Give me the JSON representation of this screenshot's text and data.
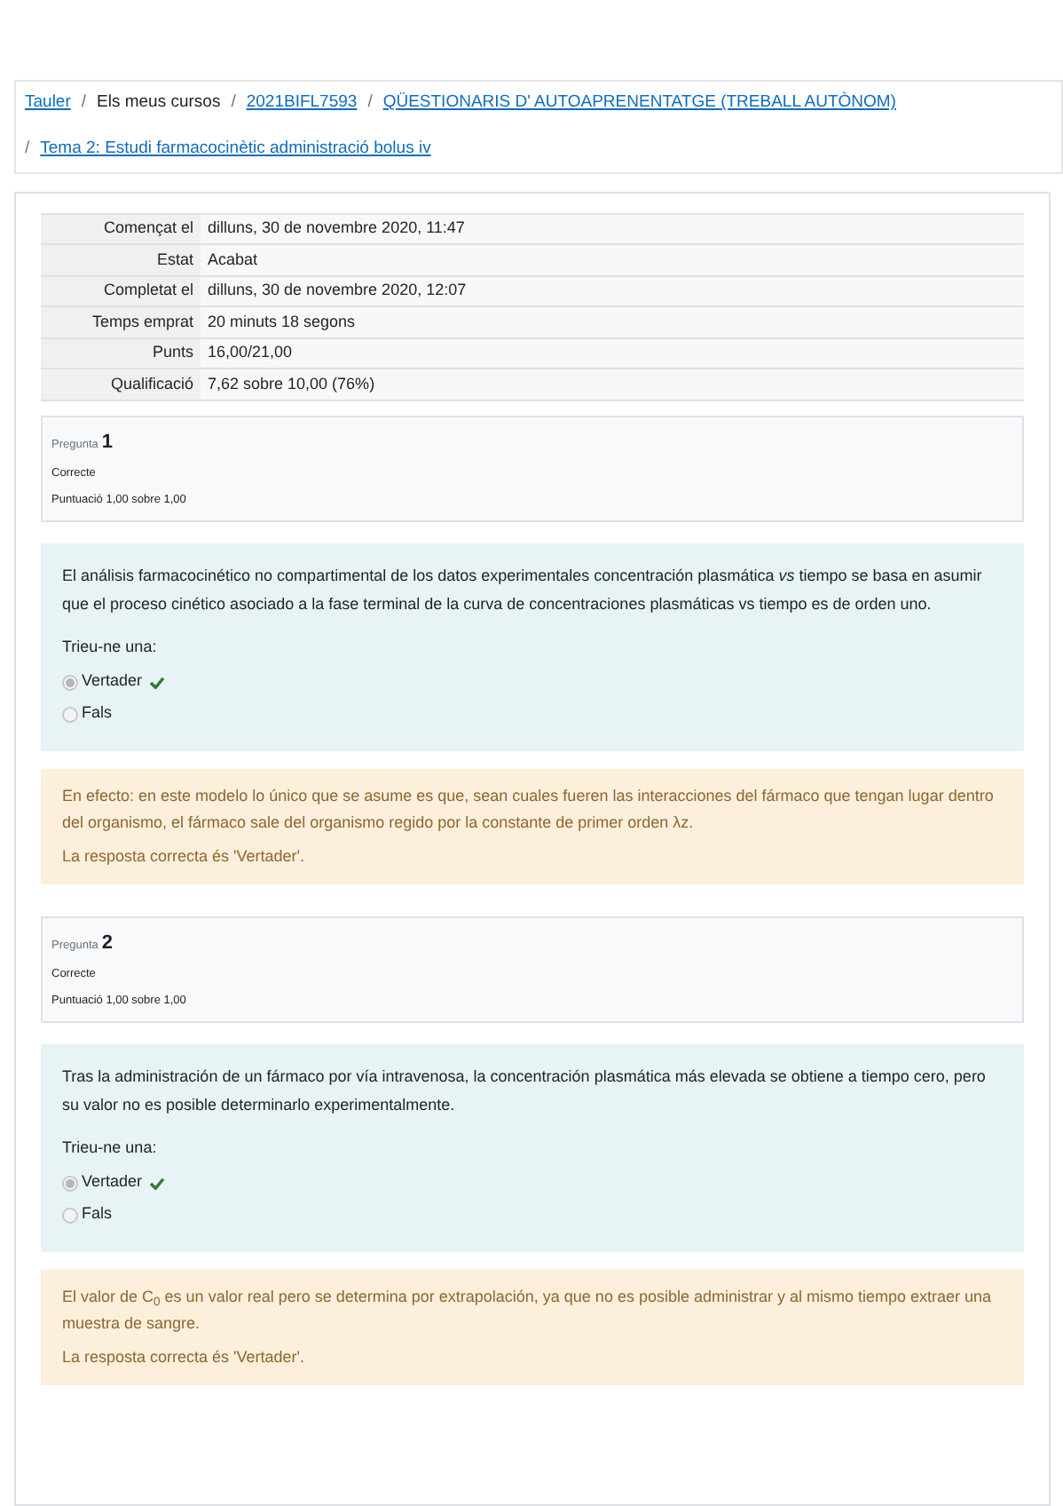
{
  "breadcrumb": [
    {
      "label": "Tauler",
      "link": true
    },
    {
      "separator": "/",
      "label": "Els meus cursos",
      "link": false
    },
    {
      "separator": "/",
      "label": "2021BIFL7593",
      "link": true
    },
    {
      "separator": "/",
      "label": "QÜESTIONARIS D' AUTOAPRENENTATGE (TREBALL AUTÒNOM)",
      "link": true
    },
    {
      "separator": "/",
      "label": "Tema 2: Estudi farmacocinètic administració bolus iv",
      "link": true
    }
  ],
  "summary": [
    {
      "label": "Començat el",
      "value": "dilluns, 30 de novembre 2020, 11:47"
    },
    {
      "label": "Estat",
      "value": "Acabat"
    },
    {
      "label": "Completat el",
      "value": "dilluns, 30 de novembre 2020, 12:07"
    },
    {
      "label": "Temps emprat",
      "value": "20 minuts 18 segons"
    },
    {
      "label": "Punts",
      "value": "16,00/21,00"
    },
    {
      "label": "Qualificació",
      "value": "7,62 sobre 10,00 (76%)"
    }
  ],
  "questions": [
    {
      "label": "Pregunta",
      "number": "1",
      "status": "Correcte",
      "score": "Puntuació 1,00 sobre 1,00",
      "text": "El análisis farmacocinético no compartimental de los datos experimentales concentración plasmática *vs* tiempo se basa en asumir que el proceso cinético asociado a la fase terminal de la curva de concentraciones plasmáticas vs tiempo es de orden uno.",
      "prompt": "Trieu-ne una:",
      "options": [
        {
          "label": "Vertader",
          "selected": true,
          "correct": true
        },
        {
          "label": "Fals",
          "selected": false,
          "correct": false
        }
      ],
      "feedback": "En efecto: en este modelo lo único que se asume es que, sean cuales fueren las interacciones del fármaco que tengan lugar dentro del organismo, el fármaco sale del organismo regido por la constante de primer orden λz.",
      "answer": "La resposta correcta és 'Vertader'."
    },
    {
      "label": "Pregunta",
      "number": "2",
      "status": "Correcte",
      "score": "Puntuació 1,00 sobre 1,00",
      "text": "Tras la administración de un fármaco por vía intravenosa, la concentración plasmática más elevada se obtiene a tiempo cero, pero su valor no es posible determinarlo experimentalmente.",
      "prompt": "Trieu-ne una:",
      "options": [
        {
          "label": "Vertader",
          "selected": true,
          "correct": true
        },
        {
          "label": "Fals",
          "selected": false,
          "correct": false
        }
      ],
      "feedback": "El valor de C$_{0}$ es un valor real pero se determina por extrapolación, ya que no es posible administrar y al mismo tiempo extraer una muestra de sangre.",
      "answer": "La resposta correcta és 'Vertader'."
    }
  ]
}
